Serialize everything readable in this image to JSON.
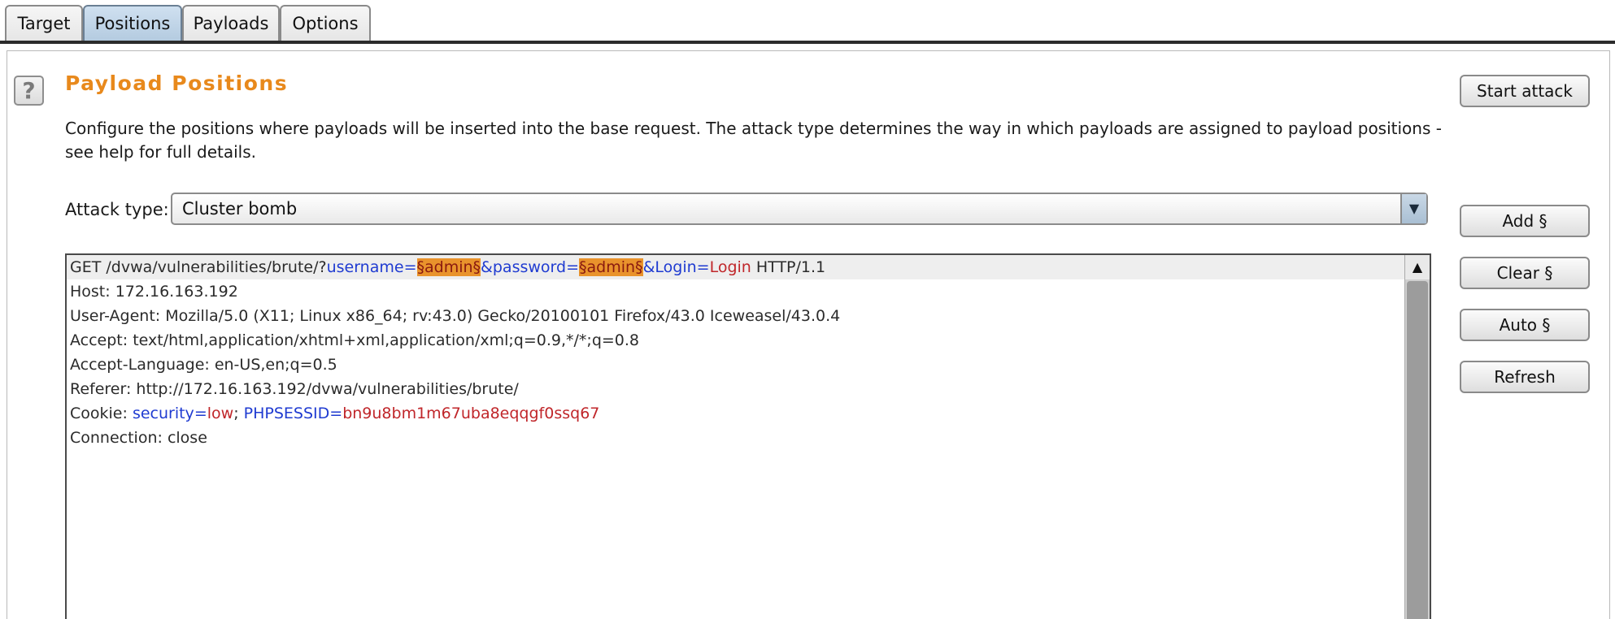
{
  "tabs": [
    {
      "label": "Target"
    },
    {
      "label": "Positions"
    },
    {
      "label": "Payloads"
    },
    {
      "label": "Options"
    }
  ],
  "panel": {
    "help_label": "?",
    "title": "Payload Positions",
    "description": "Configure the positions where payloads will be inserted into the base request. The attack type determines the way in which payloads are assigned to payload positions - see help for full details.",
    "attack_type_label": "Attack type:",
    "attack_type_value": "Cluster bomb"
  },
  "buttons": {
    "start_attack": "Start attack",
    "add": "Add §",
    "clear": "Clear §",
    "auto": "Auto §",
    "refresh": "Refresh"
  },
  "request": {
    "line1": {
      "prefix": "GET /dvwa/vulnerabilities/brute/?",
      "param1_name": "username",
      "param1_eq": "=",
      "param1_value": "§admin§",
      "amp1": "&",
      "param2_name": "password",
      "param2_eq": "=",
      "param2_value": "§admin§",
      "amp2": "&",
      "param3_name": "Login",
      "param3_eq": "=",
      "param3_value": "Login",
      "suffix": " HTTP/1.1"
    },
    "line2": "Host: 172.16.163.192",
    "line3": "User-Agent: Mozilla/5.0 (X11; Linux x86_64; rv:43.0) Gecko/20100101 Firefox/43.0 Iceweasel/43.0.4",
    "line4": "Accept: text/html,application/xhtml+xml,application/xml;q=0.9,*/*;q=0.8",
    "line5": "Accept-Language: en-US,en;q=0.5",
    "line6": "Referer: http://172.16.163.192/dvwa/vulnerabilities/brute/",
    "line7": {
      "prefix": "Cookie: ",
      "c1_name": "security",
      "c1_eq": "=",
      "c1_value": "low",
      "sep": "; ",
      "c2_name": "PHPSESSID",
      "c2_eq": "=",
      "c2_value": "bn9u8bm1m67uba8eqqgf0ssq67"
    },
    "line8": "Connection: close"
  },
  "colors": {
    "title": "#e8891c",
    "param_name": "#1f3bd1",
    "param_value": "#c0262a",
    "payload_marker_bg": "#e9932c",
    "active_tab": "#b4cbe0"
  },
  "icons": {
    "help": "help-icon",
    "dropdown": "chevron-down-icon",
    "scroll_up": "arrow-up-icon"
  }
}
